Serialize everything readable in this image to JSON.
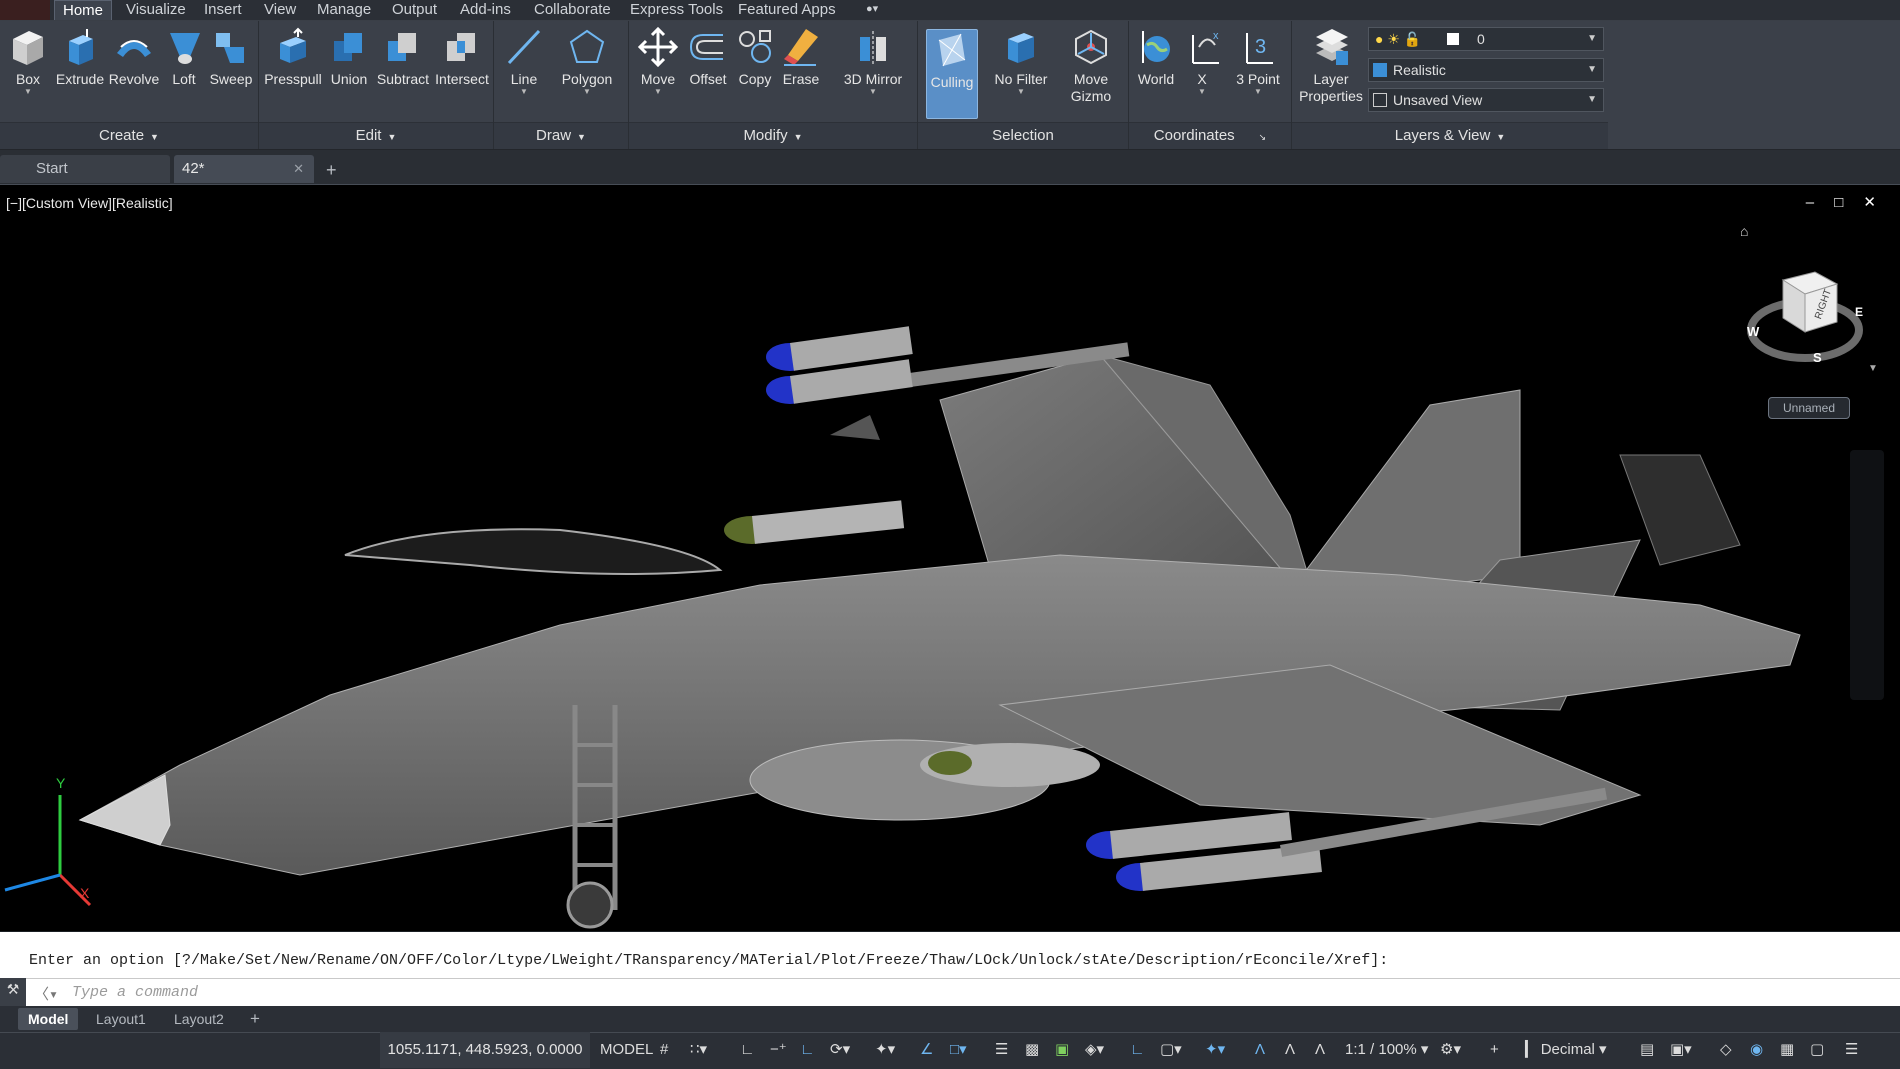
{
  "ribbon_tabs": [
    "Home",
    "Visualize",
    "Insert",
    "View",
    "Manage",
    "Output",
    "Add-ins",
    "Collaborate",
    "Express Tools",
    "Featured Apps"
  ],
  "active_tab": "Home",
  "panels": {
    "create": {
      "title": "Create",
      "tools": [
        "Box",
        "Extrude",
        "Revolve",
        "Loft",
        "Sweep"
      ]
    },
    "edit": {
      "title": "Edit",
      "tools": [
        "Presspull",
        "Union",
        "Subtract",
        "Intersect"
      ]
    },
    "draw": {
      "title": "Draw",
      "tools": [
        "Line",
        "Polygon"
      ]
    },
    "modify": {
      "title": "Modify",
      "tools": [
        "Move",
        "Offset",
        "Copy",
        "Erase",
        "3D Mirror"
      ]
    },
    "selection": {
      "title": "Selection",
      "tools": [
        "Culling",
        "No Filter",
        "Move\nGizmo"
      ]
    },
    "coordinates": {
      "title": "Coordinates",
      "tools": [
        "World",
        "X",
        "3 Point"
      ]
    },
    "layers": {
      "title": "Layers & View",
      "tools": [
        "Layer\nProperties"
      ],
      "layer_value": "0",
      "visual_style": "Realistic",
      "view": "Unsaved View"
    }
  },
  "doc_tabs": {
    "start": "Start",
    "current": "42*",
    "plus": "+"
  },
  "viewport": {
    "label": "[−][Custom View][Realistic]",
    "controls": "– □ ✕",
    "unnamed": "Unnamed",
    "viewcube_face": "RIGHT",
    "compass": {
      "w": "W",
      "s": "S",
      "e": "E"
    },
    "axes": {
      "y": "Y",
      "x": "X"
    }
  },
  "command": {
    "history": "Enter an option [?/Make/Set/New/Rename/ON/OFF/Color/Ltype/LWeight/TRansparency/MATerial/Plot/Freeze/Thaw/LOck/Unlock/stAte/Description/rEconcile/Xref]:",
    "placeholder": "Type a command"
  },
  "layout_tabs": [
    "Model",
    "Layout1",
    "Layout2"
  ],
  "status": {
    "coords": "1055.1171, 448.5923, 0.0000",
    "space": "MODEL",
    "scale": "1:1 / 100%",
    "units": "Decimal"
  },
  "colors": {
    "accent": "#5a8fc7",
    "ribbon": "#3b4049",
    "viewport": "#000000"
  }
}
